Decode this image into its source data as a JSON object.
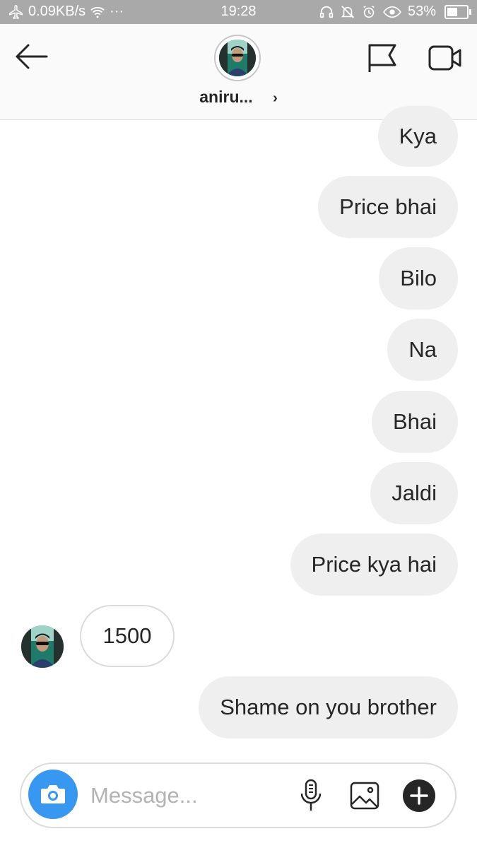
{
  "status_bar": {
    "network_speed": "0.09KB/s",
    "more": "···",
    "time": "19:28",
    "battery": "53%",
    "battery_level": 0.53
  },
  "header": {
    "username": "aniru...",
    "chevron": "›",
    "icons": [
      "back-arrow-icon",
      "flag-icon",
      "video-call-icon"
    ]
  },
  "messages": [
    {
      "sender": "me",
      "text": "Kya"
    },
    {
      "sender": "me",
      "text": "Price bhai"
    },
    {
      "sender": "me",
      "text": "Bilo"
    },
    {
      "sender": "me",
      "text": "Na"
    },
    {
      "sender": "me",
      "text": "Bhai"
    },
    {
      "sender": "me",
      "text": "Jaldi"
    },
    {
      "sender": "me",
      "text": "Price kya hai"
    },
    {
      "sender": "them",
      "text": "1500"
    },
    {
      "sender": "me",
      "text": "Shame on you brother"
    }
  ],
  "composer": {
    "placeholder": "Message...",
    "value": "",
    "icons": [
      "camera-icon",
      "microphone-icon",
      "gallery-icon",
      "plus-icon"
    ]
  },
  "colors": {
    "status_bar_bg": "#a9a9a9",
    "accent_blue": "#3897f0",
    "outgoing_bubble": "#efefef",
    "incoming_bubble_border": "#dbdbdb"
  }
}
